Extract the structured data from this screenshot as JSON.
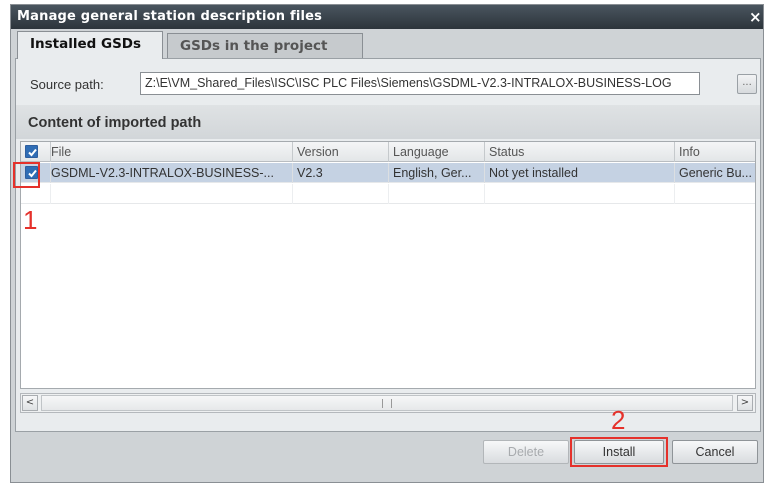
{
  "window": {
    "title": "Manage general station description files"
  },
  "tabs": [
    {
      "label": "Installed GSDs",
      "active": true
    },
    {
      "label": "GSDs in the project",
      "active": false
    }
  ],
  "source": {
    "label": "Source path:",
    "value": "Z:\\E\\VM_Shared_Files\\ISC\\ISC PLC Files\\Siemens\\GSDML-V2.3-INTRALOX-BUSINESS-LOG",
    "browse_label": "..."
  },
  "content": {
    "title": "Content of imported path",
    "columns": [
      "File",
      "Version",
      "Language",
      "Status",
      "Info"
    ],
    "rows": [
      {
        "checked": true,
        "file": "GSDML-V2.3-INTRALOX-BUSINESS-...",
        "version": "V2.3",
        "language": "English, Ger...",
        "status": "Not yet installed",
        "info": "Generic Bu..."
      }
    ]
  },
  "scrollbar": {
    "grip": "III",
    "left": "<",
    "right": ">"
  },
  "buttons": {
    "delete": "Delete",
    "install": "Install",
    "cancel": "Cancel"
  },
  "annotations": {
    "step1": "1",
    "step2": "2",
    "color": "#e5312b"
  },
  "colors": {
    "titlebar": "#2c343b",
    "selected_row": "#c5d2e3",
    "checkbox": "#2f6db5"
  }
}
